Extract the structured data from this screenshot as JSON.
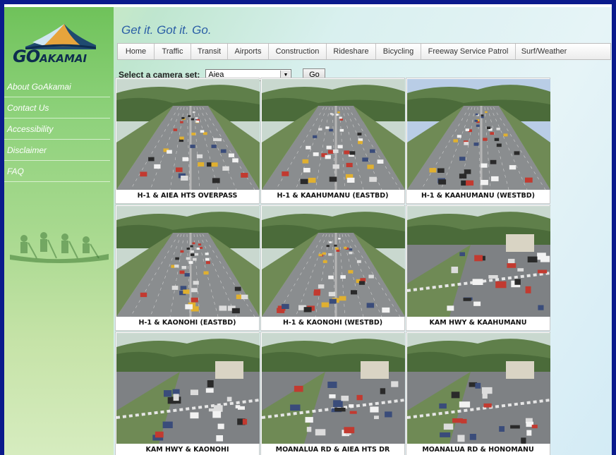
{
  "brand": {
    "logo": "GOAKAMAI",
    "logo_big": "GO",
    "logo_small": "AKAMAI",
    "tagline": "Get it. Got it. Go."
  },
  "sidebar": {
    "items": [
      {
        "label": "About GoAkamai"
      },
      {
        "label": "Contact Us"
      },
      {
        "label": "Accessibility"
      },
      {
        "label": "Disclaimer"
      },
      {
        "label": "FAQ"
      }
    ]
  },
  "topnav": {
    "tabs": [
      {
        "label": "Home"
      },
      {
        "label": "Traffic"
      },
      {
        "label": "Transit"
      },
      {
        "label": "Airports"
      },
      {
        "label": "Construction"
      },
      {
        "label": "Rideshare"
      },
      {
        "label": "Bicycling"
      },
      {
        "label": "Freeway Service Patrol"
      },
      {
        "label": "Surf/Weather"
      }
    ]
  },
  "camera_select": {
    "label": "Select a camera set:",
    "value": "Aiea",
    "go_label": "Go"
  },
  "cameras": [
    {
      "caption": "H-1 & AIEA HTS OVERPASS",
      "scene": "freeway"
    },
    {
      "caption": "H-1 & KAAHUMANU (EASTBD)",
      "scene": "freeway"
    },
    {
      "caption": "H-1 & KAAHUMANU (WESTBD)",
      "scene": "freeway-sky"
    },
    {
      "caption": "H-1 & KAONOHI (EASTBD)",
      "scene": "freeway"
    },
    {
      "caption": "H-1 & KAONOHI (WESTBD)",
      "scene": "freeway"
    },
    {
      "caption": "KAM HWY & KAAHUMANU",
      "scene": "street"
    },
    {
      "caption": "KAM HWY & KAONOHI",
      "scene": "street"
    },
    {
      "caption": "MOANALUA RD & AIEA HTS DR",
      "scene": "street"
    },
    {
      "caption": "MOANALUA RD & HONOMANU",
      "scene": "street"
    }
  ],
  "colors": {
    "frame": "#0a1a8c",
    "tagline": "#2b5fa6",
    "sidebar_green": "#7ec86a"
  }
}
